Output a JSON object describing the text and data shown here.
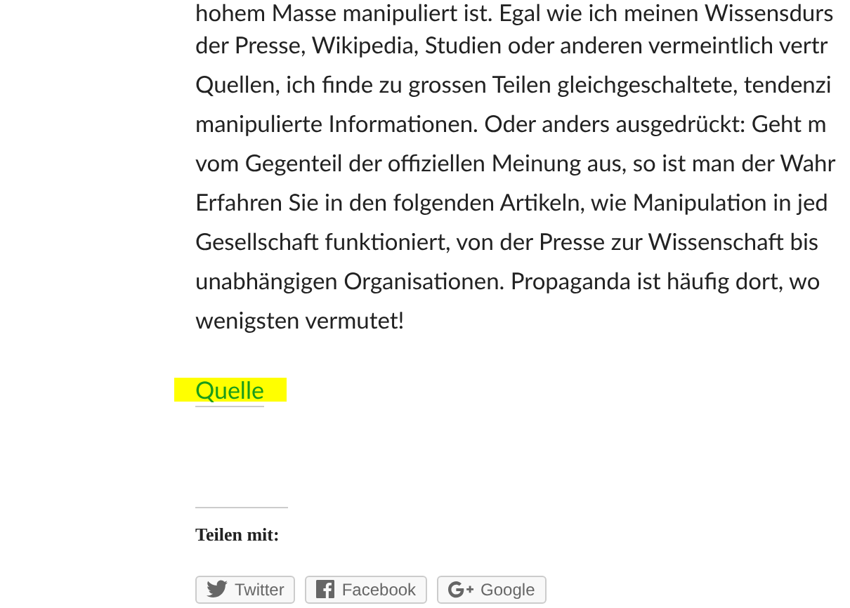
{
  "article": {
    "lines": [
      "hohem Masse manipuliert ist. Egal wie ich meinen Wissensdurs",
      "der Presse, Wikipedia, Studien oder anderen vermeintlich vertr",
      "Quellen, ich finde zu grossen Teilen gleichgeschaltete, tendenzi",
      "manipulierte Informationen. Oder anders ausgedrückt: Geht m",
      "vom Gegenteil der offiziellen Meinung aus, so ist man der Wahr",
      "Erfahren Sie in den folgenden Artikeln, wie Manipulation in jed",
      "Gesellschaft funktioniert, von der Presse zur Wissenschaft bis",
      "unabhängigen Organisationen. Propaganda ist häufig dort, wo",
      "wenigsten vermutet!"
    ],
    "source_link": {
      "label": "Quelle",
      "highlighted": true
    }
  },
  "share": {
    "title": "Teilen mit:",
    "buttons": [
      {
        "kind": "twitter",
        "label": "Twitter"
      },
      {
        "kind": "facebook",
        "label": "Facebook"
      },
      {
        "kind": "google",
        "label": "Google"
      }
    ]
  }
}
